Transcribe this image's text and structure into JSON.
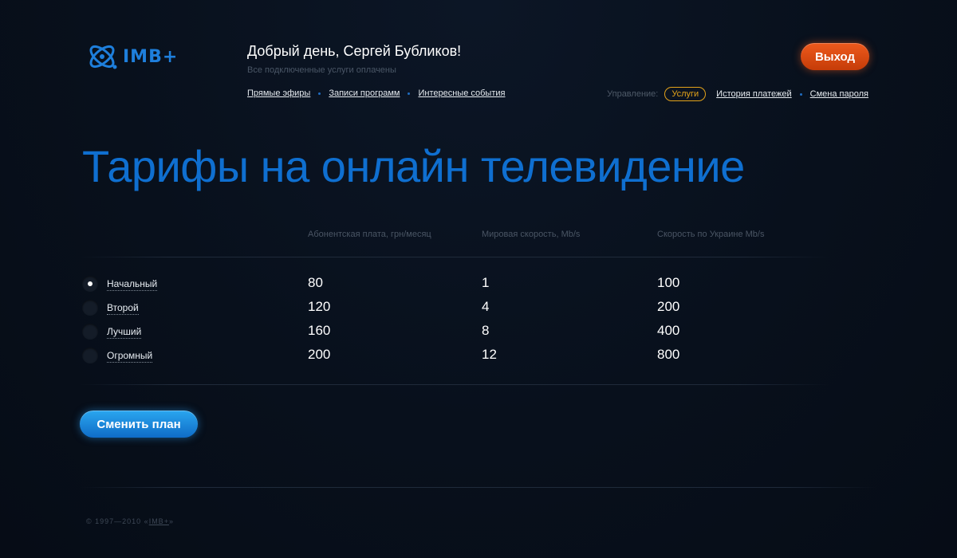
{
  "logo": {
    "text": "IMB+"
  },
  "header": {
    "greeting": "Добрый день, Сергей Бубликов!",
    "status": "Все подключенные услуги оплачены",
    "logout_label": "Выход"
  },
  "nav": {
    "left": [
      {
        "label": "Прямые эфиры"
      },
      {
        "label": "Записи программ"
      },
      {
        "label": "Интересные события"
      }
    ],
    "manage_label": "Управление:",
    "right": [
      {
        "label": "Услуги",
        "active": true
      },
      {
        "label": "История платежей"
      },
      {
        "label": "Смена пароля"
      }
    ]
  },
  "page_title": "Тарифы на онлайн телевидение",
  "table": {
    "headers": [
      "Абонентская плата, грн/месяц",
      "Мировая скорость, Mb/s",
      "Скорость по Украине Mb/s"
    ],
    "rows": [
      {
        "name": "Начальный",
        "fee": "80",
        "world_speed": "1",
        "ua_speed": "100",
        "selected": true
      },
      {
        "name": "Второй",
        "fee": "120",
        "world_speed": "4",
        "ua_speed": "200",
        "selected": false
      },
      {
        "name": "Лучший",
        "fee": "160",
        "world_speed": "8",
        "ua_speed": "400",
        "selected": false
      },
      {
        "name": "Огромный",
        "fee": "200",
        "world_speed": "12",
        "ua_speed": "800",
        "selected": false
      }
    ]
  },
  "change_plan_label": "Сменить план",
  "footer": {
    "copyright": "© 1997—2010 «",
    "brand": "IMB+",
    "close": "»"
  },
  "colors": {
    "accent_blue": "#0f6fd0",
    "logout_orange": "#e04e14",
    "active_pill": "#e3a21a",
    "background": "#08101c"
  },
  "icons": {
    "logo": "atom-orbit-icon"
  }
}
